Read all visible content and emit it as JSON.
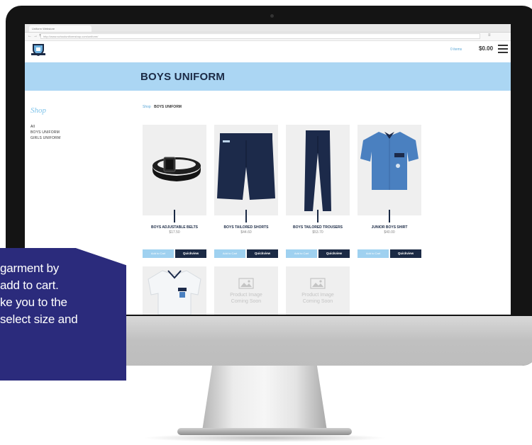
{
  "browser": {
    "tab_title": "Uniform Webstore",
    "url": "http://www.schooluniformshop.com/uniform/"
  },
  "header": {
    "cart_label": "0 items",
    "cart_total": "$0.00"
  },
  "banner": {
    "title": "BOYS UNIFORM"
  },
  "sidebar": {
    "heading": "Shop",
    "items": [
      {
        "label": "All"
      },
      {
        "label": "BOYS UNIFORM"
      },
      {
        "label": "GIRLS UNIFORM"
      }
    ]
  },
  "breadcrumb": {
    "shop": "Shop",
    "current": "BOYS UNIFORM"
  },
  "products": [
    {
      "name": "BOYS ADJUSTABLE BELTS",
      "price": "$17.50",
      "add_label": "Add to Cart",
      "quickview_label": "Quickview",
      "icon": "belt-icon"
    },
    {
      "name": "BOYS TAILORED SHORTS",
      "price": "$44.60",
      "add_label": "Add to Cart",
      "quickview_label": "Quickview",
      "icon": "shorts-icon"
    },
    {
      "name": "BOYS TAILORED TROUSERS",
      "price": "$53.70",
      "add_label": "Add to Cart",
      "quickview_label": "Quickview",
      "icon": "trousers-icon"
    },
    {
      "name": "JUNIOR BOYS SHIRT",
      "price": "$40.00",
      "add_label": "Add to Cart",
      "quickview_label": "Quickview",
      "icon": "shirt-icon"
    }
  ],
  "coming_soon": {
    "line1": "Product Image",
    "line2": "Coming Soon"
  },
  "caption": {
    "lines": [
      "garment by",
      "add to cart.",
      "ke you to the",
      "select size and"
    ]
  },
  "colors": {
    "banner": "#abd6f3",
    "navy": "#1b2a45",
    "accent_blue": "#9fd1f0",
    "caption_bg": "#2b2b7c"
  }
}
